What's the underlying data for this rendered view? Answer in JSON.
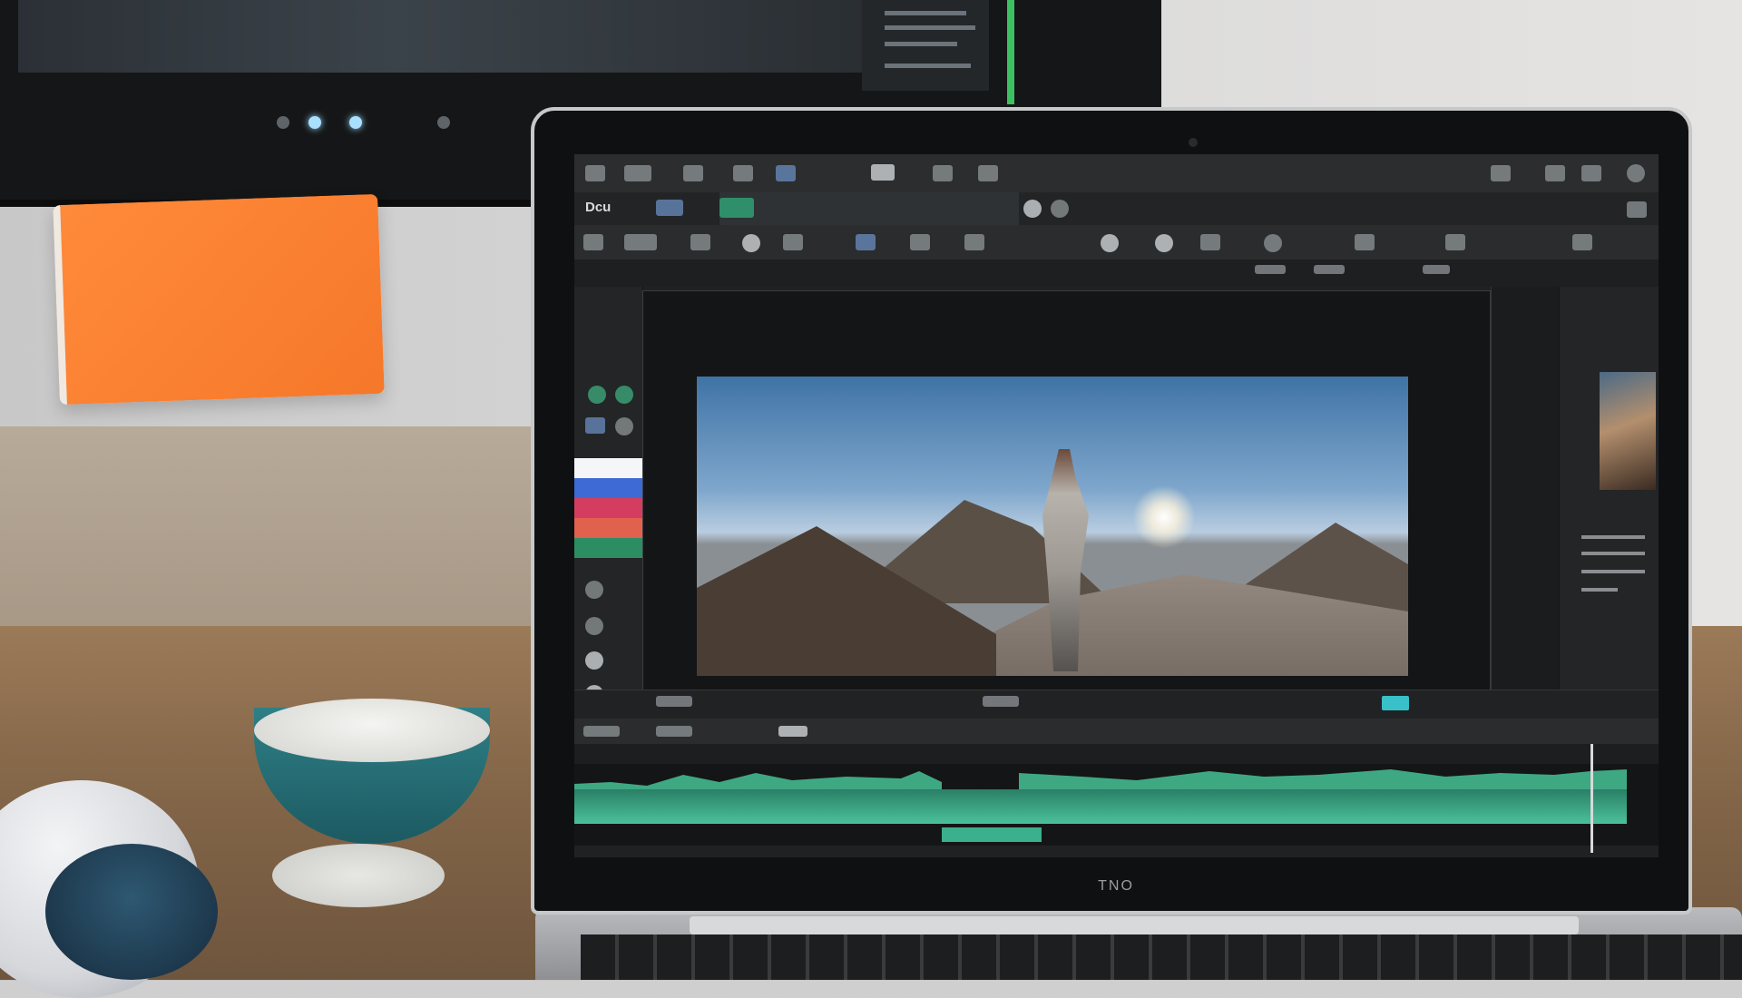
{
  "scene": {
    "brand_label": "TNO",
    "editor": {
      "app_label": "Dcu"
    }
  },
  "colors": {
    "accent_green": "#3fae7f",
    "timeline_teal": "#4ac19b",
    "sticky_orange": "#f6782a",
    "meter_green": "#3cc061"
  },
  "icons": [
    "play-icon",
    "cut-icon",
    "crop-icon",
    "folder-icon",
    "settings-icon",
    "audio-icon"
  ]
}
